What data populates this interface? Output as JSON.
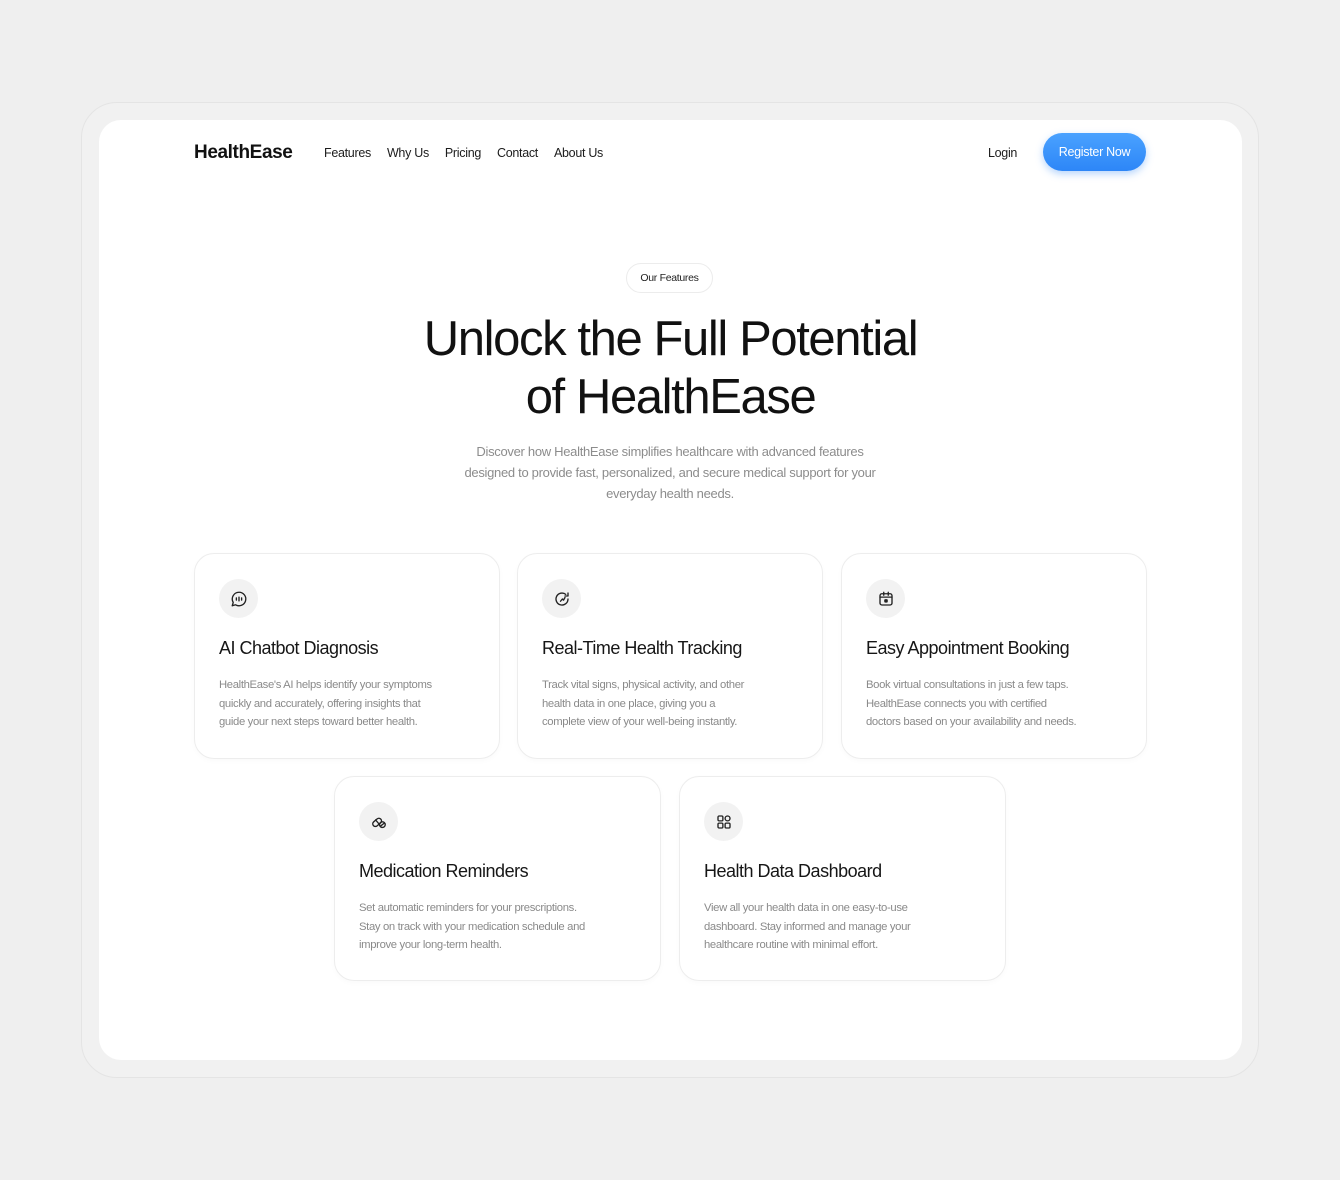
{
  "nav": {
    "logo": "HealthEase",
    "links": [
      "Features",
      "Why Us",
      "Pricing",
      "Contact",
      "About Us"
    ],
    "login": "Login",
    "register": "Register Now"
  },
  "hero": {
    "badge": "Our Features",
    "title_line1": "Unlock the Full Potential",
    "title_line2": "of HealthEase",
    "description_line1": "Discover how HealthEase simplifies healthcare with advanced features",
    "description_line2": "designed to provide fast, personalized, and secure medical support for your",
    "description_line3": "everyday health needs."
  },
  "features": [
    {
      "icon": "chat-bubble-icon",
      "title": "AI Chatbot Diagnosis",
      "desc_lines": [
        "HealthEase's AI helps identify your symptoms",
        "quickly and accurately, offering insights that",
        "guide your next steps toward better health."
      ]
    },
    {
      "icon": "refresh-pulse-icon",
      "title": "Real-Time Health Tracking",
      "desc_lines": [
        "Track vital signs, physical activity, and other",
        "health data in one place, giving you a",
        "complete view of your well-being instantly."
      ]
    },
    {
      "icon": "calendar-icon",
      "title": "Easy Appointment Booking",
      "desc_lines": [
        "Book virtual consultations in just a few taps.",
        "HealthEase connects you with certified",
        "doctors based on your availability and needs."
      ]
    },
    {
      "icon": "pill-icon",
      "title": "Medication Reminders",
      "desc_lines": [
        "Set automatic reminders for your prescriptions.",
        "Stay on track with your medication schedule and",
        "improve your long-term health."
      ]
    },
    {
      "icon": "dashboard-grid-icon",
      "title": "Health Data Dashboard",
      "desc_lines": [
        "View all your health data in one easy-to-use",
        "dashboard. Stay informed and manage your",
        "healthcare routine with minimal effort."
      ]
    }
  ],
  "colors": {
    "accent": "#2d86f7",
    "background": "#efefef",
    "card_border": "#ededed",
    "muted_text": "#8a8a8a"
  }
}
